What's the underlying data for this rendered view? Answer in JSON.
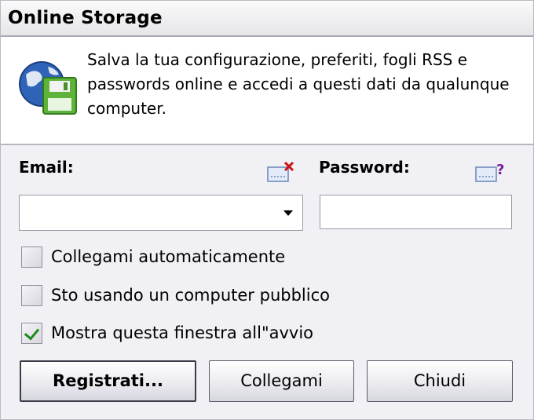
{
  "window": {
    "title": "Online Storage"
  },
  "info": {
    "text": "Salva la tua configurazione, preferiti, fogli RSS e passwords online e accedi a questi dati da qualunque computer.",
    "icon": "globe-floppy-icon"
  },
  "form": {
    "email_label": "Email:",
    "password_label": "Password:",
    "email_value": "",
    "password_value": ""
  },
  "options": [
    {
      "label": "Collegami automaticamente",
      "checked": false
    },
    {
      "label": "Sto usando un computer pubblico",
      "checked": false
    },
    {
      "label": "Mostra questa finestra all\"avvio",
      "checked": true
    }
  ],
  "buttons": {
    "register": "Registrati...",
    "login": "Collegami",
    "close": "Chiudi"
  },
  "colors": {
    "check": "#1a8a1a",
    "clear_x": "#cc1111",
    "help_q": "#7a1f9a"
  }
}
